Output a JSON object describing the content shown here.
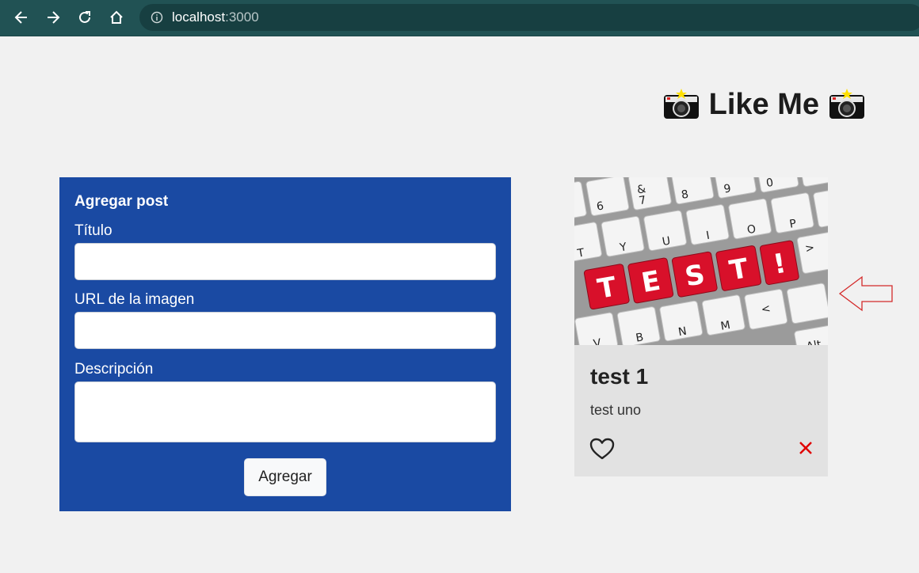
{
  "browser": {
    "url_host": "localhost",
    "url_port": ":3000",
    "icons": [
      "back-icon",
      "forward-icon",
      "reload-icon",
      "home-icon",
      "info-icon"
    ]
  },
  "app": {
    "title": "Like Me",
    "title_icon": "camera-with-flash-icon"
  },
  "form": {
    "heading": "Agregar post",
    "title_label": "Título",
    "title_value": "",
    "url_label": "URL de la imagen",
    "url_value": "",
    "description_label": "Descripción",
    "description_value": "",
    "submit_label": "Agregar",
    "background": "#1a4aa3"
  },
  "posts": [
    {
      "image_keyboard_keys": [
        "6",
        "&",
        "7",
        "8",
        "9",
        "0",
        "T",
        "Y",
        "U",
        "I",
        "O",
        "P",
        "V",
        "B",
        "N",
        "M",
        "<",
        ">",
        "Alt"
      ],
      "image_red_keys": [
        "T",
        "E",
        "S",
        "T",
        "!"
      ],
      "title": "test 1",
      "description": "test uno",
      "like_icon": "heart-outline-icon",
      "delete_icon": "close-icon",
      "delete_color": "#e00000",
      "liked": false
    }
  ],
  "annotation": {
    "arrow_icon": "left-arrow-outline-icon",
    "color": "#d42a2a"
  }
}
